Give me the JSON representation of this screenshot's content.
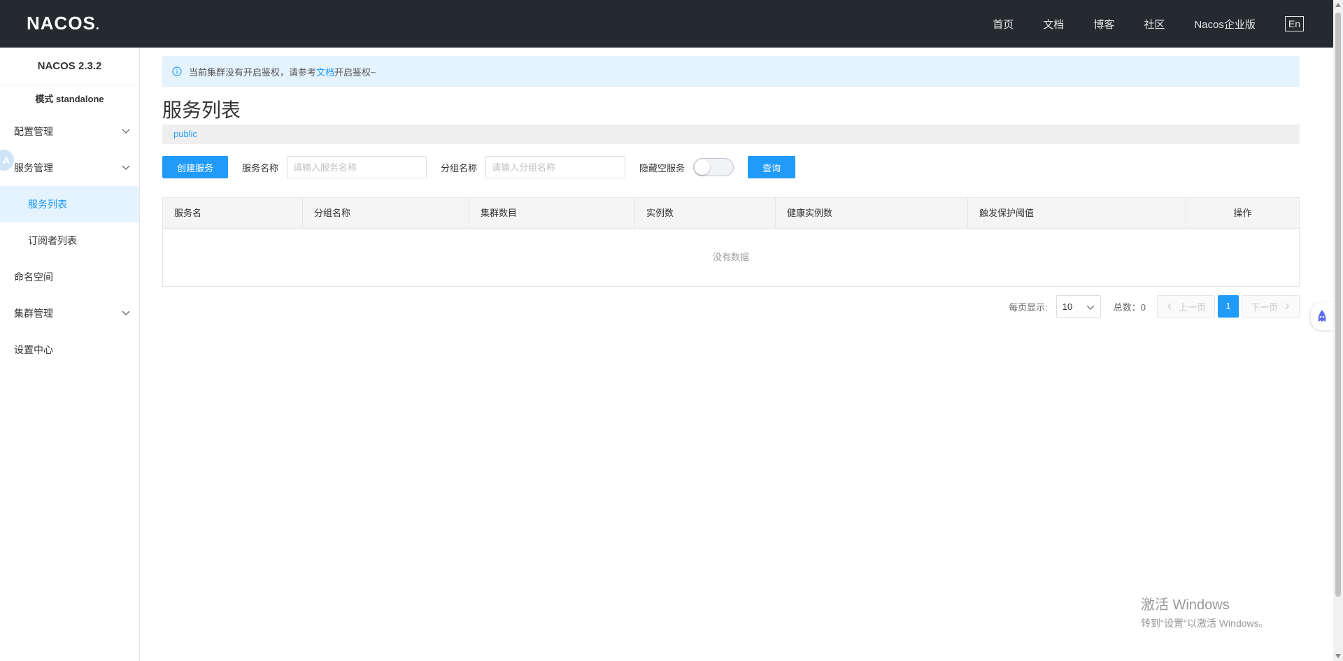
{
  "header": {
    "logo": "NACOS",
    "nav": [
      "首页",
      "文档",
      "博客",
      "社区",
      "Nacos企业版"
    ],
    "lang": "En"
  },
  "sidebar": {
    "version": "NACOS 2.3.2",
    "mode": "模式 standalone",
    "avatar_letter": "A",
    "items": [
      {
        "label": "配置管理",
        "expandable": true
      },
      {
        "label": "服务管理",
        "expandable": true
      },
      {
        "label": "服务列表",
        "sub": true,
        "active": true
      },
      {
        "label": "订阅者列表",
        "sub": true
      },
      {
        "label": "命名空间"
      },
      {
        "label": "集群管理",
        "expandable": true
      },
      {
        "label": "设置中心"
      }
    ]
  },
  "notice": {
    "before": "当前集群没有开启鉴权，请参考",
    "link": "文档",
    "after": "开启鉴权~"
  },
  "page_title": "服务列表",
  "namespace": "public",
  "filter": {
    "create_button": "创建服务",
    "service_name_label": "服务名称",
    "service_name_placeholder": "请输入服务名称",
    "group_name_label": "分组名称",
    "group_name_placeholder": "请输入分组名称",
    "hide_empty_label": "隐藏空服务",
    "hide_empty_on": false,
    "query_button": "查询"
  },
  "table": {
    "columns": [
      "服务名",
      "分组名称",
      "集群数目",
      "实例数",
      "健康实例数",
      "触发保护阈值",
      "操作"
    ],
    "rows": [],
    "empty_text": "没有数据"
  },
  "pagination": {
    "per_page_label": "每页显示:",
    "per_page_value": "10",
    "total_label": "总数：0",
    "prev": "上一页",
    "current_page": "1",
    "next": "下一页"
  },
  "watermark": {
    "line1": "激活 Windows",
    "line2": "转到\"设置\"以激活 Windows。"
  },
  "colors": {
    "header_bg": "#252a2f",
    "accent": "#209bfa",
    "active_bg": "#e4f3fe"
  }
}
